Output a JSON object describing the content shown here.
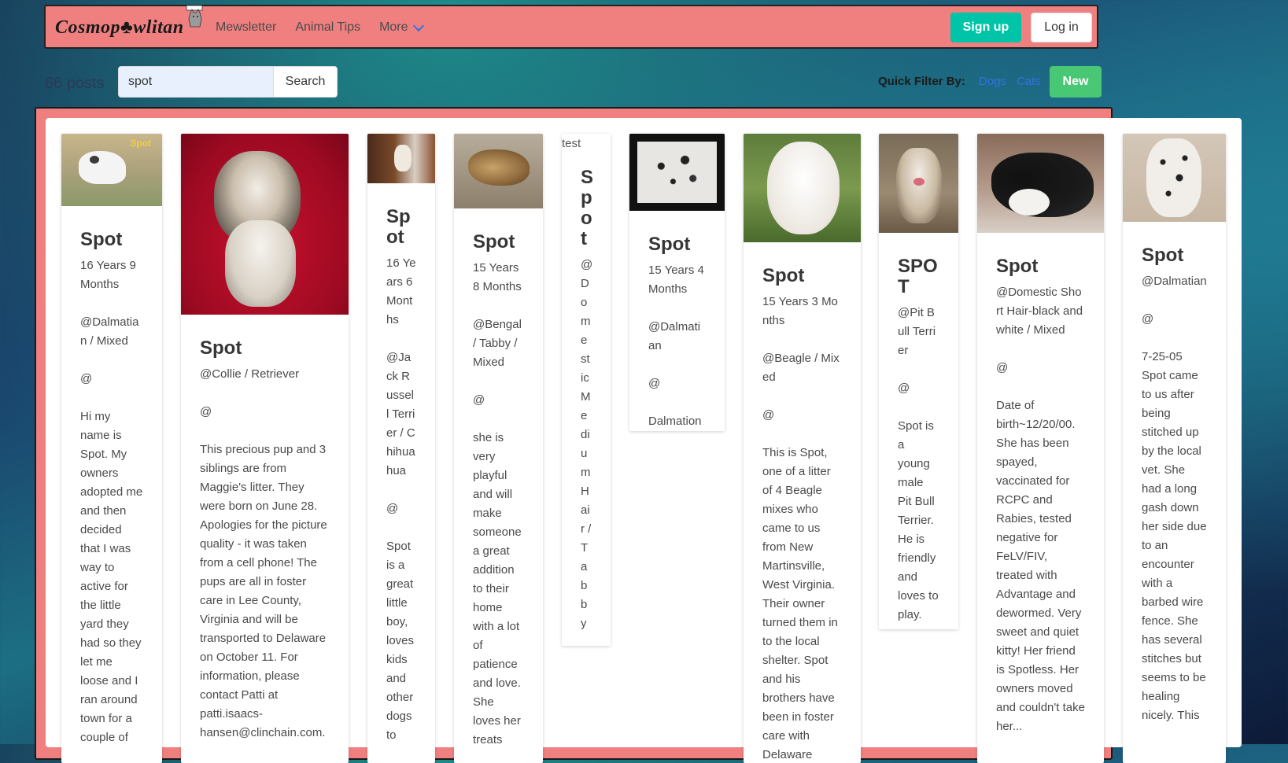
{
  "navbar": {
    "brand": "Cosmop♣wlitan",
    "links": [
      "Mewsletter",
      "Animal Tips",
      "More"
    ],
    "signup": "Sign up",
    "login": "Log in"
  },
  "toolbar": {
    "post_count": "66 posts",
    "search_value": "spot",
    "search_button": "Search",
    "quick_filter_label": "Quick Filter By:",
    "filter_dogs": "Dogs",
    "filter_cats": "Cats",
    "new_button": "New"
  },
  "colors": {
    "navbar": "#f08080",
    "signup": "#00c4a7",
    "new": "#48c774",
    "link": "#3273dc"
  },
  "cards": [
    {
      "title": "Spot",
      "age": "16 Years 9 Months",
      "breed": "@Dalmatian / Mixed",
      "at": "@",
      "desc": "Hi my name is Spot. My owners adopted me and then decided that I was way to active for the little yard they had so they let me loose and I ran around town for a couple of",
      "photo_caption": "Spot"
    },
    {
      "title": "Spot",
      "age": "",
      "breed": "@Collie / Retriever",
      "at": "@",
      "desc": "This precious pup and 3 siblings are from Maggie's litter. They were born on June 28. Apologies for the picture quality - it was taken from a cell phone! The pups are all in foster care in Lee County, Virginia and will be transported to Delaware on October 11. For information, please contact Patti at patti.isaacs-hansen@clinchain.com."
    },
    {
      "title": "Spot",
      "age": "16 Years 6 Months",
      "breed": "@Jack Russell Terrier / Chihuahua",
      "at": "@",
      "desc": "Spot is a great little boy, loves kids and other dogs to"
    },
    {
      "title": "Spot",
      "age": "15 Years 8 Months",
      "breed": "@Bengal / Tabby / Mixed",
      "at": "@",
      "desc": "she is very playful and will make someone a great addition to their home with a lot of patience and love. She loves her treats"
    },
    {
      "title": "Spot",
      "age": "",
      "breed": "@Domestic Medium Hair / Tabby",
      "at": "@",
      "desc": "",
      "broken_alt": "test"
    },
    {
      "title": "Spot",
      "age": "15 Years 4 Months",
      "breed": "@Dalmatian",
      "at": "@",
      "desc": "Dalmation"
    },
    {
      "title": "Spot",
      "age": "15 Years 3 Months",
      "breed": "@Beagle / Mixed",
      "at": "@",
      "desc": "This is Spot, one of a litter of 4 Beagle mixes who came to us from New Martinsville, West Virginia. Their owner turned them in to the local shelter. Spot and his brothers have been in foster care with Delaware"
    },
    {
      "title": "SPOT",
      "age": "",
      "breed": "@Pit Bull Terrier",
      "at": "@",
      "desc": "Spot is a young male Pit Bull Terrier. He is friendly and loves to play."
    },
    {
      "title": "Spot",
      "age": "",
      "breed": "@Domestic Short Hair-black and white / Mixed",
      "at": "@",
      "desc": "Date of birth~12/20/00. She has been spayed, vaccinated for RCPC and Rabies, tested negative for FeLV/FIV, treated with Advantage and dewormed. Very sweet and quiet kitty! Her friend is Spotless. Her owners moved and couldn't take her..."
    },
    {
      "title": "Spot",
      "age": "",
      "breed": "@Dalmatian",
      "at": "@",
      "desc": "7-25-05 Spot came to us after being stitched up by the local vet. She had a long gash down her side due to an encounter with a barbed wire fence. She has several stitches but seems to be healing nicely. This"
    }
  ]
}
